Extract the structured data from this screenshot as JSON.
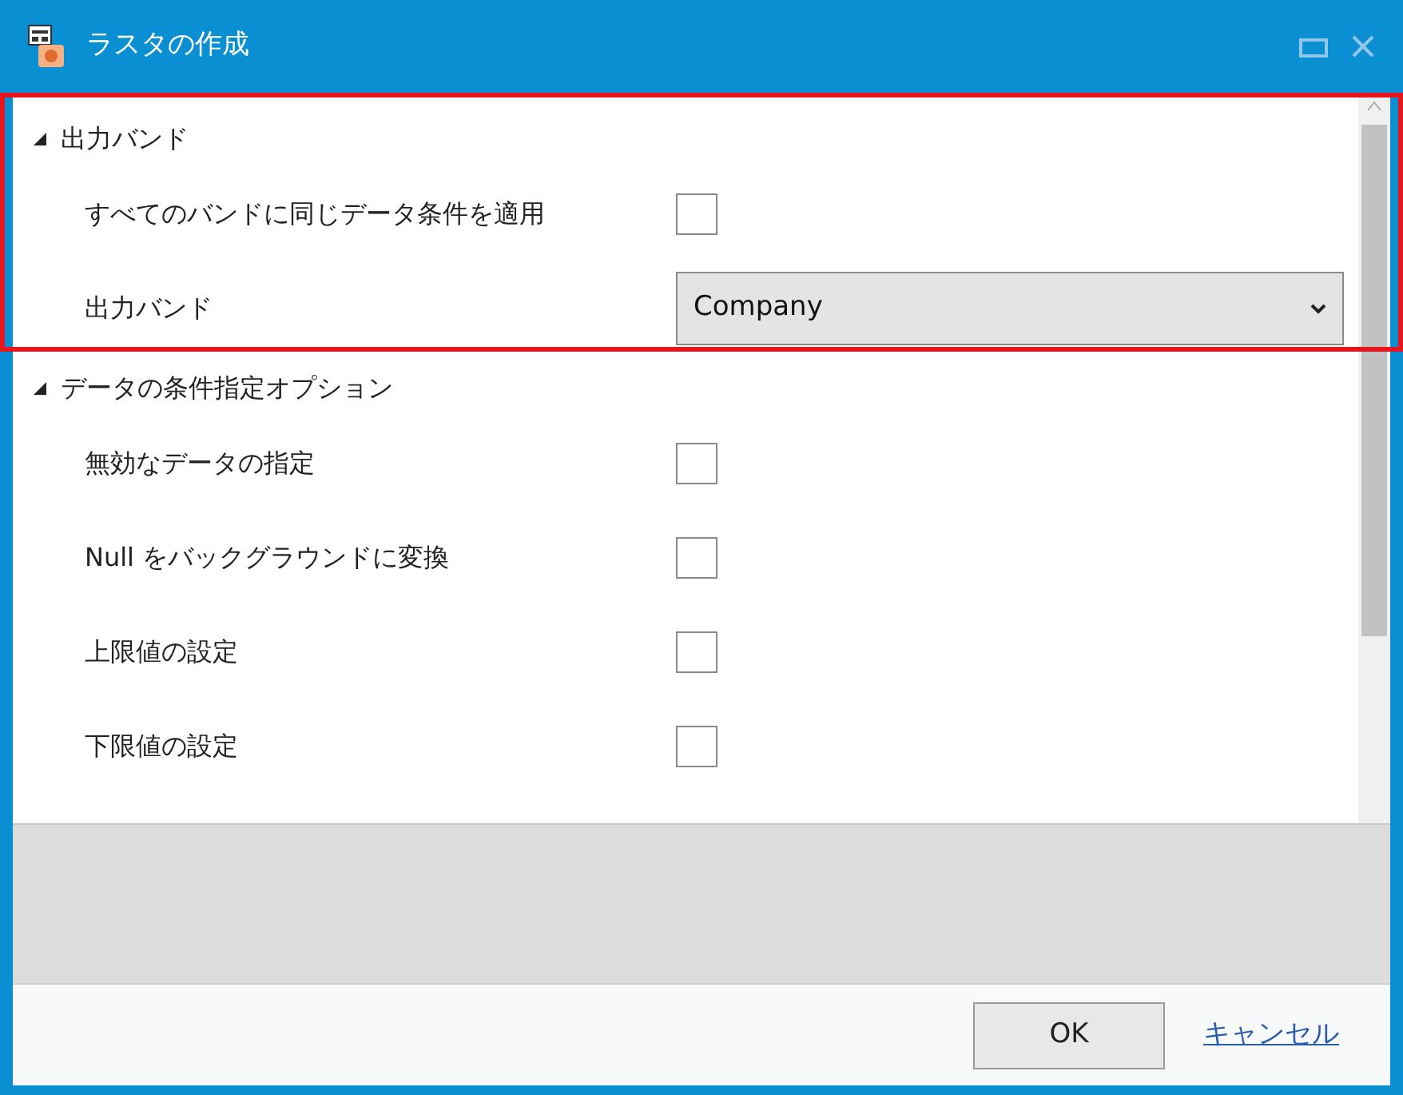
{
  "window": {
    "title": "ラスタの作成"
  },
  "sections": [
    {
      "title": "出力バンド",
      "expanded": true,
      "highlighted": true,
      "rows": [
        {
          "kind": "checkbox",
          "label": "すべてのバンドに同じデータ条件を適用",
          "checked": false
        },
        {
          "kind": "dropdown",
          "label": "出力バンド",
          "value": "Company"
        }
      ]
    },
    {
      "title": "データの条件指定オプション",
      "expanded": true,
      "highlighted": false,
      "rows": [
        {
          "kind": "checkbox",
          "label": "無効なデータの指定",
          "checked": false
        },
        {
          "kind": "checkbox",
          "label": "Null をバックグラウンドに変換",
          "checked": false
        },
        {
          "kind": "checkbox",
          "label": "上限値の設定",
          "checked": false
        },
        {
          "kind": "checkbox",
          "label": "下限値の設定",
          "checked": false
        }
      ]
    }
  ],
  "buttons": [
    {
      "kind": "button",
      "label": "OK"
    },
    {
      "kind": "link",
      "label": "キャンセル"
    }
  ]
}
